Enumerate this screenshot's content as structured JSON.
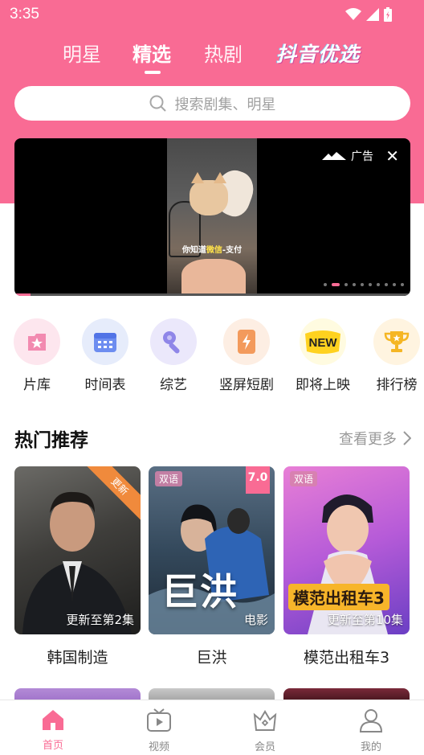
{
  "status_bar": {
    "time": "3:35"
  },
  "top_nav": {
    "tabs": [
      "明星",
      "精选",
      "热剧"
    ],
    "active_tab": "精选",
    "promo_label": "抖音优选"
  },
  "search": {
    "placeholder": "搜索剧集、明星"
  },
  "banner": {
    "ad_label": "广告",
    "video_caption_prefix": "你知道",
    "video_caption_highlight": "微信",
    "video_caption_suffix": "-支付",
    "page_count": 10,
    "active_page": 2,
    "progress": 0.04
  },
  "categories": [
    {
      "label": "片库",
      "icon": "star-box-icon",
      "bg": "#fde6ee"
    },
    {
      "label": "时间表",
      "icon": "calendar-icon",
      "bg": "#e6ecfb"
    },
    {
      "label": "综艺",
      "icon": "microphone-icon",
      "bg": "#ebe8fb"
    },
    {
      "label": "竖屏短剧",
      "icon": "phone-lightning-icon",
      "bg": "#fdeee3"
    },
    {
      "label": "即将上映",
      "icon": "new-badge-icon",
      "bg": "#fffbe0"
    },
    {
      "label": "排行榜",
      "icon": "trophy-icon",
      "bg": "#fff4e0"
    }
  ],
  "hot": {
    "title": "热门推荐",
    "more_label": "查看更多"
  },
  "cards": [
    {
      "title": "韩国制造",
      "note": "更新至第2集",
      "ribbon": "更新",
      "tag": "",
      "score": ""
    },
    {
      "title": "巨洪",
      "note": "电影",
      "ribbon": "",
      "tag": "双语",
      "score": "7.0",
      "poster_text": "巨洪"
    },
    {
      "title": "模范出租车3",
      "note": "更新至第10集",
      "ribbon": "",
      "tag": "双语",
      "score": "",
      "poster_text": "模范出租车3"
    }
  ],
  "tab_bar": {
    "items": [
      {
        "label": "首页",
        "icon": "home-icon"
      },
      {
        "label": "视频",
        "icon": "tv-play-icon"
      },
      {
        "label": "会员",
        "icon": "crown-icon"
      },
      {
        "label": "我的",
        "icon": "user-icon"
      }
    ],
    "active": "首页"
  },
  "colors": {
    "accent": "#f96b94",
    "ribbon": "#f08a3c"
  }
}
